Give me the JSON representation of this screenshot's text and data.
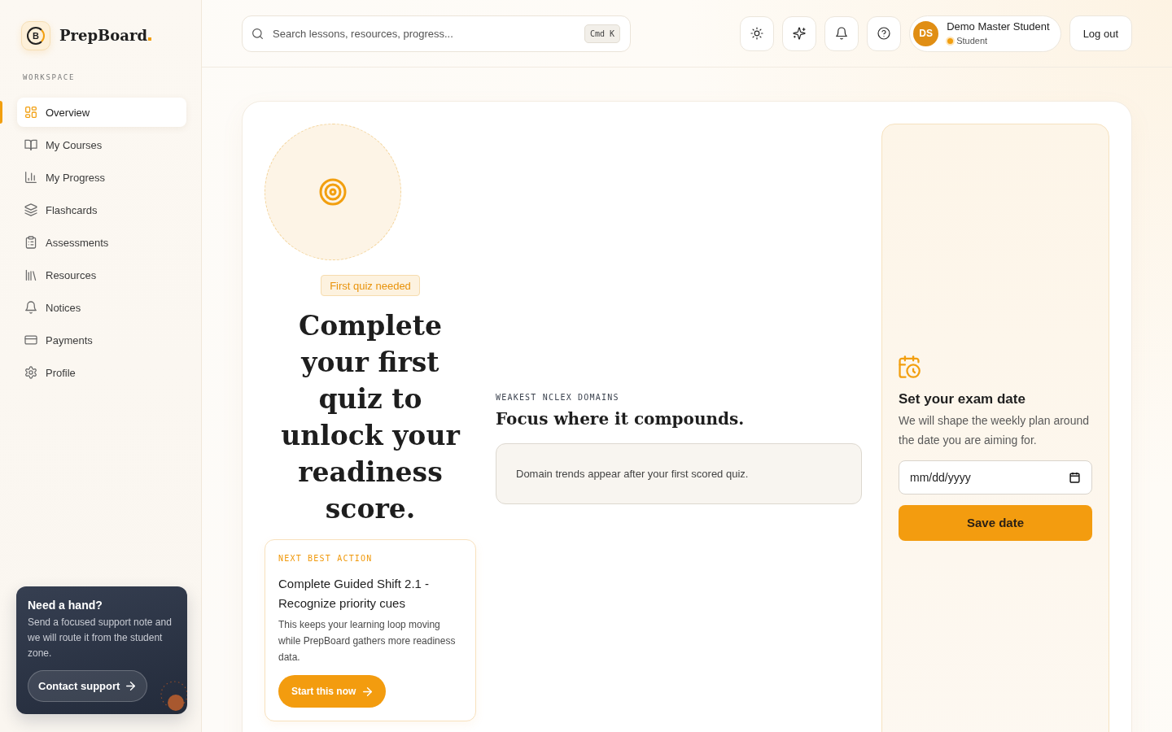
{
  "sidebar": {
    "logo_mark": "B",
    "brand": "PrepBoard",
    "section_label": "WORKSPACE",
    "items": [
      {
        "label": "Overview",
        "selected": true
      },
      {
        "label": "My Courses",
        "selected": false
      },
      {
        "label": "My Progress",
        "selected": false
      },
      {
        "label": "Flashcards",
        "selected": false
      },
      {
        "label": "Assessments",
        "selected": false
      },
      {
        "label": "Resources",
        "selected": false
      },
      {
        "label": "Notices",
        "selected": false
      },
      {
        "label": "Payments",
        "selected": false
      },
      {
        "label": "Profile",
        "selected": false
      }
    ],
    "help_card": {
      "title": "Need a hand?",
      "text": "Send a focused support note and we will route it from the student zone.",
      "button": "Contact support"
    }
  },
  "top_bar": {
    "search": {
      "placeholder": "Search lessons, resources, progress...",
      "shortcut": "Cmd K"
    },
    "user": {
      "initials": "DS",
      "name": "Demo Master Student",
      "role": "Student"
    },
    "logout_button": "Log out"
  },
  "readiness": {
    "badge": "First quiz needed",
    "heading": "Complete your first quiz to unlock your readiness score."
  },
  "next_action": {
    "label": "NEXT BEST ACTION",
    "title": "Complete Guided Shift 2.1 - Recognize priority cues",
    "text": "This keeps your learning loop moving while PrepBoard gathers more readiness data.",
    "button": "Start this now"
  },
  "domains": {
    "label": "WEAKEST NCLEX DOMAINS",
    "heading": "Focus where it compounds.",
    "empty_text": "Domain trends appear after your first scored quiz."
  },
  "exam_date": {
    "title": "Set your exam date",
    "text": "We will shape the weekly plan around the date you are aiming for.",
    "placeholder": "mm/dd/yyyy",
    "button": "Save date"
  }
}
